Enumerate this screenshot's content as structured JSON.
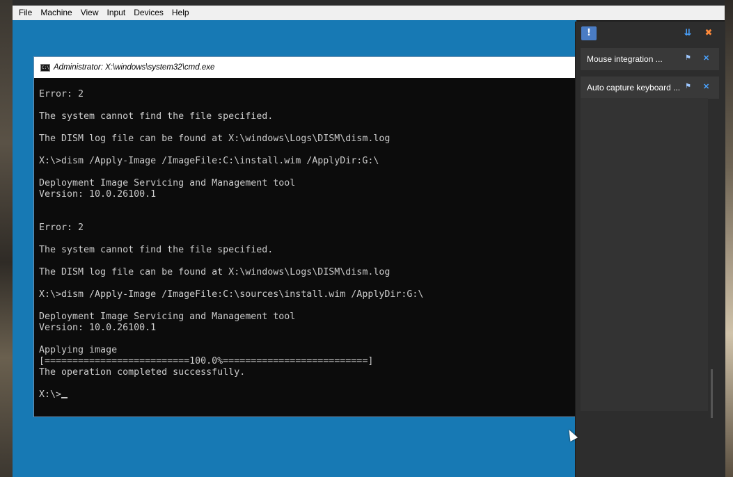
{
  "menubar": {
    "items": [
      "File",
      "Machine",
      "View",
      "Input",
      "Devices",
      "Help"
    ]
  },
  "cmd_window": {
    "title": "Administrator: X:\\windows\\system32\\cmd.exe",
    "icon": "cmd-icon",
    "lines": [
      "",
      "Error: 2",
      "",
      "The system cannot find the file specified.",
      "",
      "The DISM log file can be found at X:\\windows\\Logs\\DISM\\dism.log",
      "",
      "X:\\>dism /Apply-Image /ImageFile:C:\\install.wim /ApplyDir:G:\\",
      "",
      "Deployment Image Servicing and Management tool",
      "Version: 10.0.26100.1",
      "",
      "",
      "Error: 2",
      "",
      "The system cannot find the file specified.",
      "",
      "The DISM log file can be found at X:\\windows\\Logs\\DISM\\dism.log",
      "",
      "X:\\>dism /Apply-Image /ImageFile:C:\\sources\\install.wim /ApplyDir:G:\\",
      "",
      "Deployment Image Servicing and Management tool",
      "Version: 10.0.26100.1",
      "",
      "Applying image",
      "[==========================100.0%==========================]",
      "The operation completed successfully.",
      ""
    ],
    "prompt": "X:\\>"
  },
  "notification_panel": {
    "notes": [
      {
        "label": "Mouse integration ..."
      },
      {
        "label": "Auto capture keyboard ..."
      }
    ],
    "icons": {
      "toggle": "notification-icon",
      "sort": "sort-icon",
      "dismiss_all": "dismiss-all-icon",
      "pin": "pin-icon",
      "close": "close-icon"
    },
    "colors": {
      "accent": "#4aa3ff",
      "panel_bg": "#2d2d2d"
    }
  },
  "colors": {
    "desktop": "#1779b4",
    "console_bg": "#0c0c0c",
    "console_fg": "#cccccc"
  }
}
